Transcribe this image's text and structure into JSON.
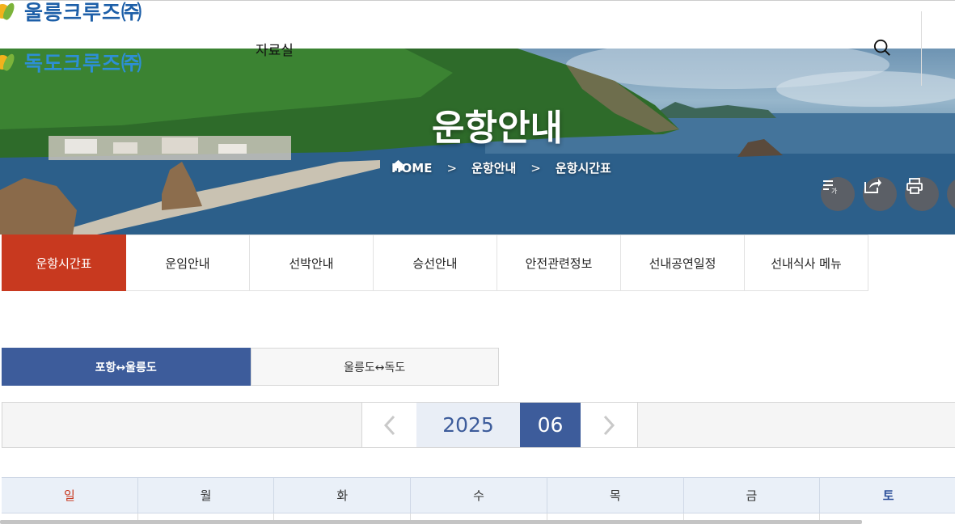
{
  "header": {
    "logo_primary": "울릉크루즈㈜",
    "logo_secondary": "독도크루즈㈜",
    "nav_item": "자료실",
    "search_icon": "search-icon"
  },
  "hero": {
    "title": "운항안내",
    "breadcrumb": {
      "home": "HOME",
      "sep": ">",
      "level1": "운항안내",
      "level2": "운항시간표"
    },
    "tools": [
      "text-size-icon",
      "share-icon",
      "print-icon",
      "more-icon"
    ]
  },
  "tabs": [
    {
      "label": "운항시간표",
      "active": true
    },
    {
      "label": "운임안내",
      "active": false
    },
    {
      "label": "선박안내",
      "active": false
    },
    {
      "label": "승선안내",
      "active": false
    },
    {
      "label": "안전관련정보",
      "active": false
    },
    {
      "label": "선내공연일정",
      "active": false
    },
    {
      "label": "선내식사 메뉴",
      "active": false
    }
  ],
  "routes": [
    {
      "label": "포항↔울릉도",
      "active": true
    },
    {
      "label": "울릉도↔독도",
      "active": false
    }
  ],
  "calendar": {
    "year": "2025",
    "month": "06",
    "prev_icon": "chevron-left-icon",
    "next_icon": "chevron-right-icon",
    "weekdays": [
      "일",
      "월",
      "화",
      "수",
      "목",
      "금",
      "토"
    ]
  },
  "colors": {
    "accent_red": "#c8391f",
    "accent_blue": "#3d5c9b",
    "header_bg": "#eaf0f8"
  }
}
